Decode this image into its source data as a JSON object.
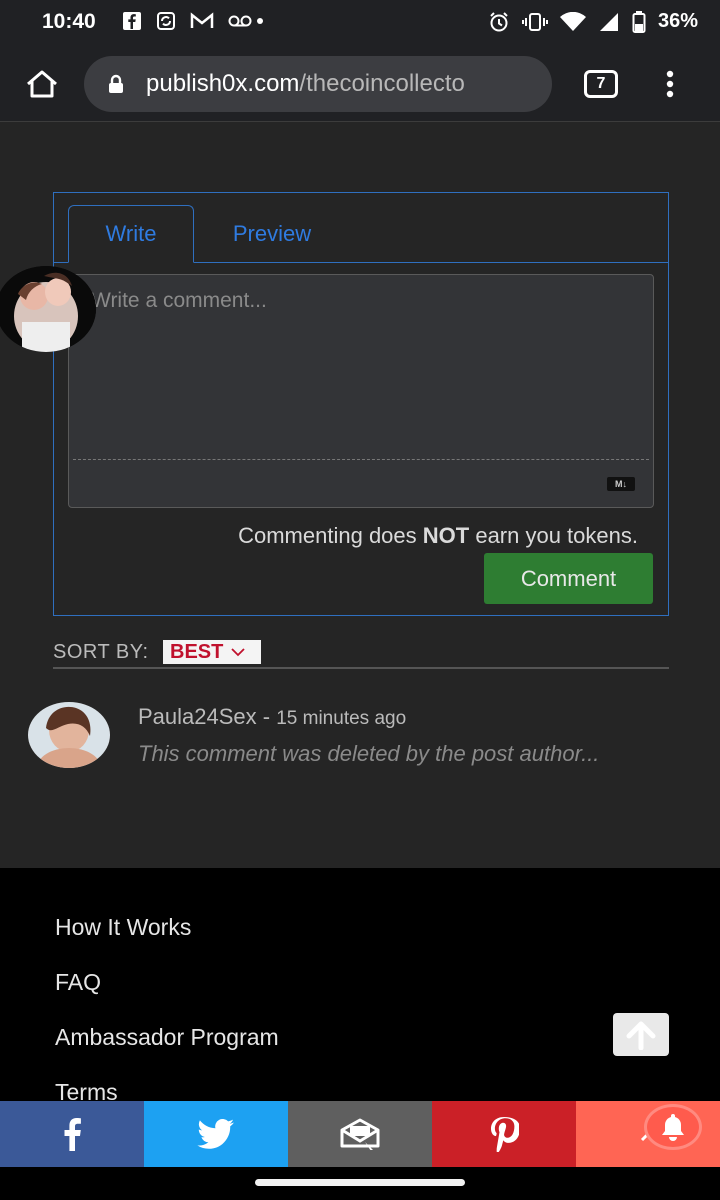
{
  "status_bar": {
    "time": "10:40",
    "battery": "36%",
    "left_icons": [
      "facebook-icon",
      "sync-icon",
      "gmail-icon",
      "voicemail-icon"
    ],
    "right_icons": [
      "alarm-icon",
      "vibrate-icon",
      "wifi-icon",
      "signal-icon",
      "battery-icon"
    ]
  },
  "browser": {
    "url_host": "publish0x.com",
    "url_path": "/thecoincollecto",
    "tab_count": "7"
  },
  "editor": {
    "tabs": [
      {
        "label": "Write",
        "active": true
      },
      {
        "label": "Preview",
        "active": false
      }
    ],
    "placeholder": "Write a comment...",
    "markdown_badge": "M↓",
    "notice_pre": "Commenting does ",
    "notice_bold": "NOT",
    "notice_post": " earn you tokens.",
    "submit_label": "Comment"
  },
  "sort": {
    "label": "SORT BY:",
    "selected": "BEST"
  },
  "comments": [
    {
      "author": "Paula24Sex",
      "separator": " - ",
      "time": "15 minutes ago",
      "body": "This comment was deleted by the post author..."
    }
  ],
  "footer": {
    "links": [
      "How It Works",
      "FAQ",
      "Ambassador Program",
      "Terms"
    ]
  },
  "share_bar": [
    {
      "icon": "facebook-icon",
      "color": "#3b5998"
    },
    {
      "icon": "twitter-icon",
      "color": "#1da1f2"
    },
    {
      "icon": "email-icon",
      "color": "#5f5f5f"
    },
    {
      "icon": "pinterest-icon",
      "color": "#cb2027"
    },
    {
      "icon": "share-icon",
      "color": "#ff6554"
    }
  ],
  "colors": {
    "accent_blue": "#2f7be0",
    "comment_button": "#2e7d32",
    "sort_red": "#c0112d"
  }
}
